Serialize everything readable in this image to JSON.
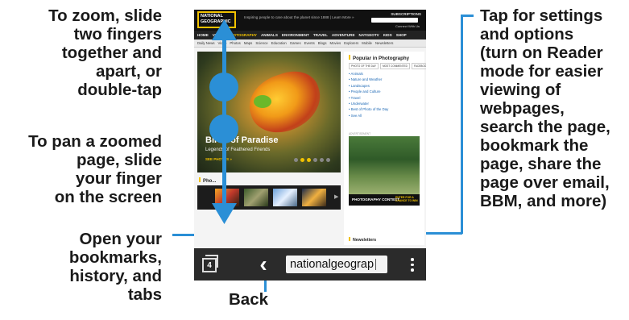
{
  "callouts": {
    "zoom": [
      "To zoom, slide",
      "two fingers",
      "together and",
      "apart, or",
      "double-tap"
    ],
    "pan": [
      "To pan a zoomed",
      "page, slide",
      "your finger",
      "on the screen"
    ],
    "bookmarks": [
      "Open your",
      "bookmarks,",
      "history, and",
      "tabs"
    ],
    "back": "Back",
    "settings": [
      "Tap for settings",
      "and options",
      "(turn on Reader",
      "mode for easier",
      "viewing of",
      "webpages,",
      "search the page,",
      "bookmark the",
      "page, share the",
      "page over email,",
      "BBM, and more)"
    ]
  },
  "site": {
    "logo": [
      "NATIONAL",
      "GEOGRAPHIC"
    ],
    "tagline": "Inspiring people to care about the planet since 1888  |  Learn More »",
    "subscriptions": "SUBSCRIPTIONS",
    "connect": "Connect With Us",
    "nav": [
      "HOME",
      "VIDEO",
      "PHOTOGRAPHY",
      "ANIMALS",
      "ENVIRONMENT",
      "TRAVEL",
      "ADVENTURE",
      "NATGEOTV",
      "KIDS",
      "SHOP"
    ],
    "subnav": [
      "Daily News",
      "Video",
      "Photos",
      "Maps",
      "Science",
      "Education",
      "Games",
      "Events",
      "Blogs",
      "Movies",
      "Explorers",
      "Mobile",
      "Newsletters"
    ],
    "hero": {
      "title": "Birds of Paradise",
      "subtitle": "Legends of Feathered Friends",
      "cta": "SEE PHOTOS »"
    },
    "popular": {
      "title": "Popular in Photography",
      "tabs": [
        "PHOTO OF THE DAY",
        "MOST COMMENTED",
        "FACEBOOK"
      ],
      "items": [
        "Animals",
        "Nature and Weather",
        "Landscapes",
        "People and Culture",
        "Travel",
        "Underwater",
        "Best of Photo of the Day",
        "See All"
      ]
    },
    "ad": {
      "label": "ADVERTISEMENT",
      "text": "PHOTOGRAPHY CONTEST",
      "cta": "ENTER FOR A CHANCE TO WIN"
    },
    "photo_heading": "Pho...",
    "newsletters": "Newsletters"
  },
  "toolbar": {
    "tab_count": "4",
    "back_glyph": "‹",
    "address": "nationalgeograp"
  }
}
